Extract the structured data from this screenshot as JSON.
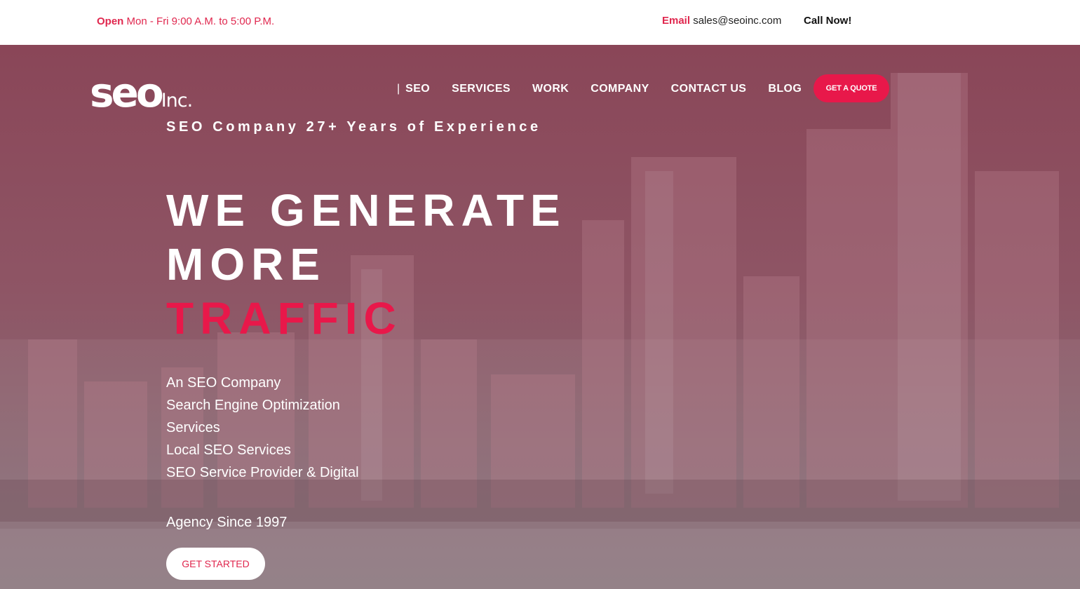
{
  "topbar": {
    "open_label": "Open",
    "hours": "Mon - Fri 9:00 A.M. to 5:00 P.M.",
    "email_label": "Email",
    "email_value": "sales@seoinc.com",
    "call_label": "Call Now!"
  },
  "logo": {
    "main": "seo",
    "suffix": "Inc."
  },
  "nav": {
    "separator": "|",
    "items": [
      "SEO",
      "SERVICES",
      "WORK",
      "COMPANY",
      "CONTACT US",
      "BLOG"
    ]
  },
  "quote_button": "GET A QUOTE",
  "hero": {
    "tagline": "SEO Company 27+ Years of Experience",
    "headline_line1": "WE GENERATE",
    "headline_line2": "MORE",
    "headline_line3": "TRAFFIC",
    "features": [
      "An SEO Company",
      "Search Engine Optimization",
      "Services",
      "Local SEO Services",
      "SEO Service Provider & Digital"
    ],
    "since": "Agency Since 1997",
    "cta": "GET STARTED"
  },
  "colors": {
    "accent": "#e8184a",
    "overlay": "#8a4658"
  }
}
